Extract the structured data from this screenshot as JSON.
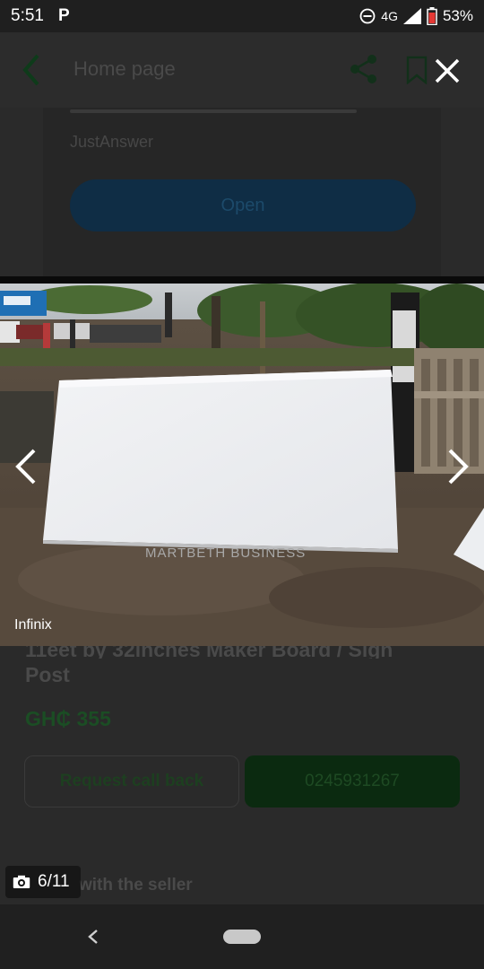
{
  "status_bar": {
    "time": "5:51",
    "notification_icon": "P",
    "network": "4G",
    "battery": "53%"
  },
  "header": {
    "title": "Home page"
  },
  "ad": {
    "brand": "JustAnswer",
    "open_label": "Open"
  },
  "listing": {
    "title_partial": "11eet by 32inches Maker Board / Sign",
    "title_line2": "Post",
    "price": "GH₵ 355",
    "request_callback_label": "Request call back",
    "phone": "0245931267",
    "chat_text": "with the seller"
  },
  "viewer": {
    "photo_watermark": "MARTBETH BUSINESS",
    "camera_label": "Infinix",
    "counter": "6/11"
  },
  "icons": [
    "battery-icon",
    "signal-icon",
    "dnd-icon",
    "back-icon",
    "share-icon",
    "bookmark-icon",
    "close-icon",
    "chevron-left-icon",
    "chevron-right-icon",
    "camera-icon",
    "nav-back-icon"
  ]
}
